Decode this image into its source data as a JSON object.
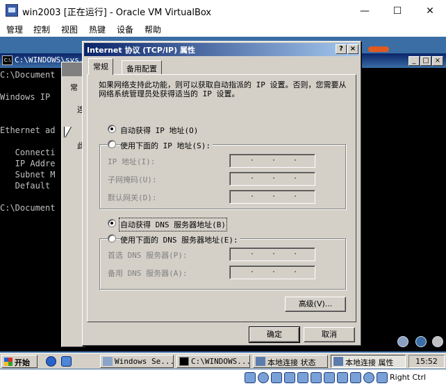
{
  "host": {
    "title": "win2003 [正在运行] - Oracle VM VirtualBox",
    "menu": [
      "管理",
      "控制",
      "视图",
      "热键",
      "设备",
      "帮助"
    ],
    "minimize": "—",
    "maximize": "☐",
    "close": "✕"
  },
  "console": {
    "title": "C:\\WINDOWS\\sys...",
    "lines": {
      "l1": "C:\\Document",
      "l2": "Windows IP",
      "l3": "Ethernet ad",
      "l4": "   Connecti",
      "l5": "   IP Addre",
      "l6": "   Subnet M",
      "l7": "   Default ",
      "l8": "C:\\Document"
    },
    "btn_min": "_",
    "btn_max": "□",
    "btn_close": "×"
  },
  "bgwin": {
    "tab": "常",
    "side_a": "连",
    "side_b": "此"
  },
  "dialog": {
    "title": "Internet 协议 (TCP/IP) 属性",
    "help_btn": "?",
    "close_btn": "×",
    "tabs": [
      "常规",
      "备用配置"
    ],
    "description": "如果网络支持此功能，则可以获取自动指派的 IP 设置。否则，您需要从网络系统管理员处获得适当的 IP 设置。",
    "ip_auto": "自动获得 IP 地址(O)",
    "ip_manual": "使用下面的 IP 地址(S):",
    "ip_fields": {
      "ip": "IP 地址(I):",
      "mask": "子网掩码(U):",
      "gateway": "默认网关(D):"
    },
    "dns_auto": "自动获得 DNS 服务器地址(B)",
    "dns_manual": "使用下面的 DNS 服务器地址(E):",
    "dns_fields": {
      "preferred": "首选 DNS 服务器(P):",
      "alternate": "备用 DNS 服务器(A):"
    },
    "advanced": "高级(V)...",
    "ok": "确定",
    "cancel": "取消"
  },
  "taskbar": {
    "start": "开始",
    "tasks": [
      "Windows Se...",
      "C:\\WINDOWS...",
      "本地连接 状态",
      "本地连接 属性"
    ],
    "clock": "15:52"
  },
  "statusbar": {
    "host_key": "Right Ctrl"
  }
}
